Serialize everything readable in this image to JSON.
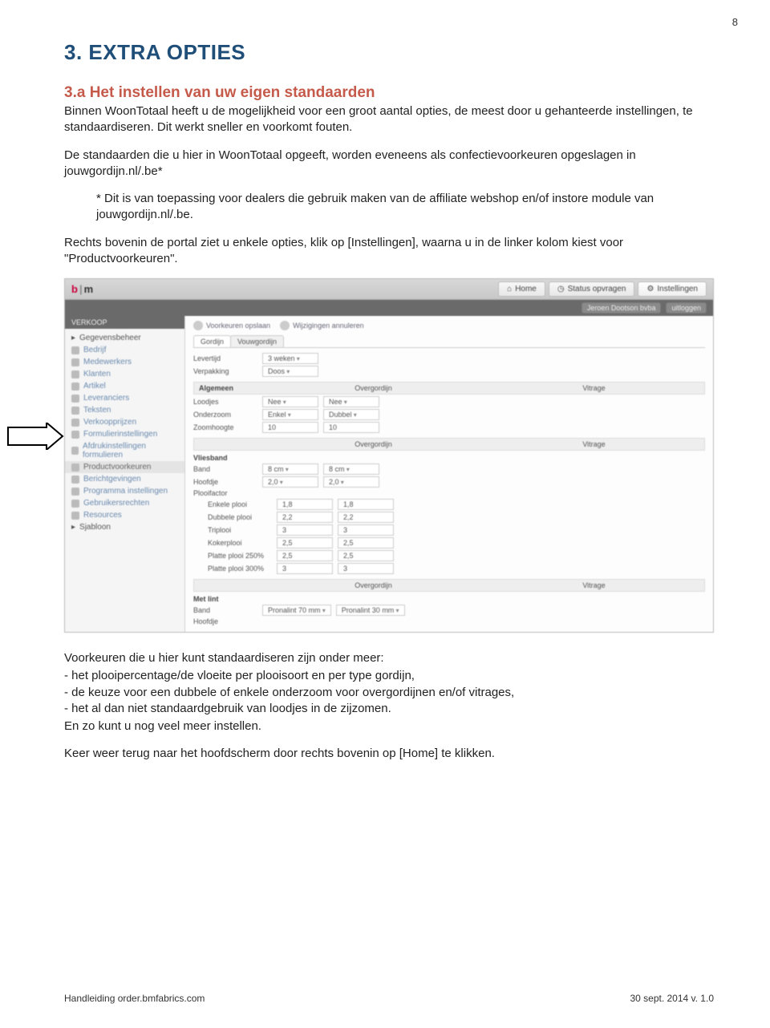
{
  "page_number": "8",
  "heading": "3. EXTRA OPTIES",
  "sub_heading": "3.a Het instellen van uw eigen standaarden",
  "para1": "Binnen WoonTotaal heeft u de mogelijkheid voor een groot aantal opties, de meest door u gehanteerde instellingen, te standaardiseren. Dit werkt sneller en voorkomt fouten.",
  "para2": "De standaarden die u hier in WoonTotaal opgeeft, worden eveneens als confectievoorkeuren opgeslagen in jouwgordijn.nl/.be*",
  "para3": "* Dit is van toepassing voor dealers die gebruik maken van de affiliate webshop en/of instore module van jouwgordijn.nl/.be.",
  "para4": "Rechts bovenin de portal ziet u enkele opties, klik op [Instellingen], waarna u in de linker kolom kiest voor \"Productvoorkeuren\".",
  "para5": "Voorkeuren die u hier kunt standaardiseren zijn onder meer:",
  "bullet1": "- het plooipercentage/de vloeite per plooisoort en per type gordijn,",
  "bullet2": "- de keuze voor een dubbele of enkele onderzoom voor overgordijnen en/of vitrages,",
  "bullet3": "- het al dan niet standaardgebruik van loodjes in de zijzomen.",
  "para6": "En zo kunt u nog veel meer instellen.",
  "para7": "Keer weer terug naar het hoofdscherm door rechts bovenin op [Home] te klikken.",
  "footer_left": "Handleiding order.bmfabrics.com",
  "footer_right": "30 sept. 2014 v. 1.0",
  "app": {
    "logo_b": "b",
    "logo_m": "m",
    "tab_home": "Home",
    "tab_status": "Status opvragen",
    "tab_settings": "Instellingen",
    "user_text": "Jeroen Dootson bvba",
    "logout": "uitloggen",
    "side_header": "VERKOOP",
    "side_group": "Gegevensbeheer",
    "side_items": [
      "Bedrijf",
      "Medewerkers",
      "Klanten",
      "Artikel",
      "Leveranciers",
      "Teksten",
      "Verkoopprijzen",
      "Formulierinstellingen",
      "Afdrukinstellingen formulieren",
      "Productvoorkeuren",
      "Berichtgevingen",
      "Programma instellingen",
      "Gebruikersrechten",
      "Resources"
    ],
    "side_item_last": "Sjabloon",
    "btn_save": "Voorkeuren opslaan",
    "btn_cancel": "Wijzigingen annuleren",
    "tab_gordijn": "Gordijn",
    "tab_vouw": "Vouwgordijn",
    "f_levertijd_l": "Levertijd",
    "f_levertijd_v": "3 weken",
    "f_verpakking_l": "Verpakking",
    "f_verpakking_v": "Doos",
    "sec_algemeen": "Algemeen",
    "col_over": "Overgordijn",
    "col_vit": "Vitrage",
    "f_loodjes_l": "Loodjes",
    "f_loodjes_v1": "Nee",
    "f_loodjes_v2": "Nee",
    "f_onderzoom_l": "Onderzoom",
    "f_onderzoom_v1": "Enkel",
    "f_onderzoom_v2": "Dubbel",
    "f_zoomhoogte_l": "Zoomhoogte",
    "f_zoomhoogte_v1": "10",
    "f_zoomhoogte_v2": "10",
    "sec_vliesband": "Vliesband",
    "f_band_l": "Band",
    "f_band_v1": "8 cm",
    "f_band_v2": "8 cm",
    "f_hoofdje_l": "Hoofdje",
    "f_hoofdje_v1": "2,0",
    "f_hoofdje_v2": "2,0",
    "f_plooifactor_l": "Plooifactor",
    "pl1_l": "Enkele plooi",
    "pl1_v1": "1,8",
    "pl1_v2": "1,8",
    "pl2_l": "Dubbele plooi",
    "pl2_v1": "2,2",
    "pl2_v2": "2,2",
    "pl3_l": "Triplooi",
    "pl3_v1": "3",
    "pl3_v2": "3",
    "pl4_l": "Kokerplooi",
    "pl4_v1": "2,5",
    "pl4_v2": "2,5",
    "pl5_l": "Platte plooi 250%",
    "pl5_v1": "2,5",
    "pl5_v2": "2,5",
    "pl6_l": "Platte plooi 300%",
    "pl6_v1": "3",
    "pl6_v2": "3",
    "sec_metlint": "Met lint",
    "f_band2_l": "Band",
    "f_band2_v1": "Pronalint 70 mm",
    "f_band2_v2": "Pronalint 30 mm",
    "f_hoofdje2_l": "Hoofdje"
  }
}
